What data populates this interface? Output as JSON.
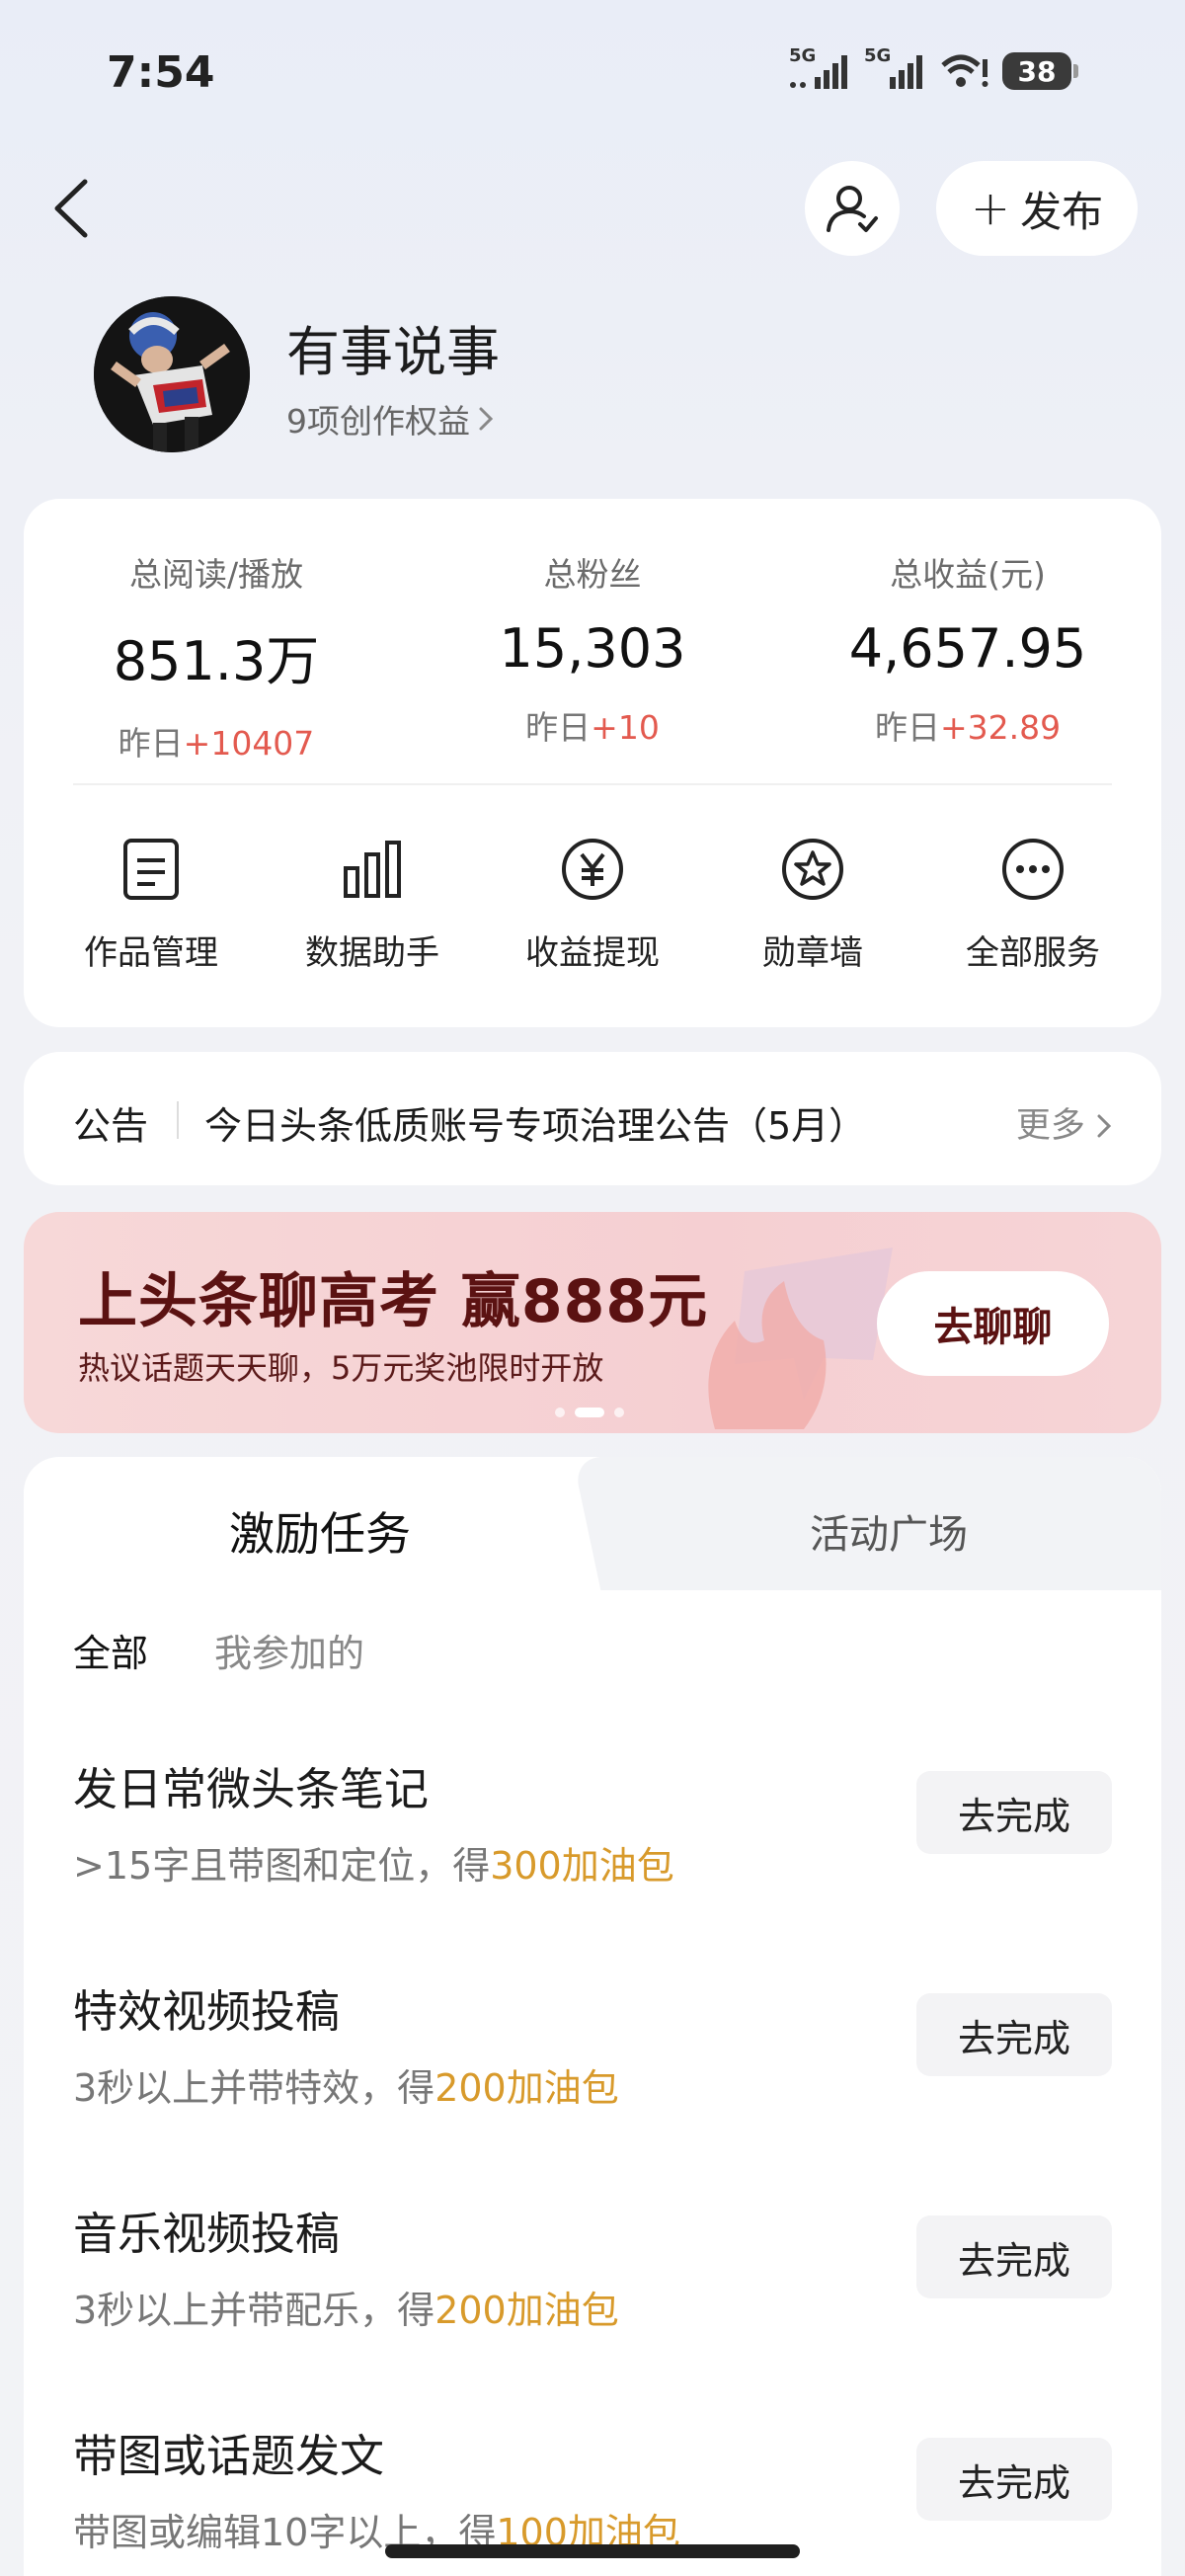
{
  "status_bar": {
    "time": "7:54",
    "network_1": "5G",
    "network_2": "5G",
    "battery": "38"
  },
  "header": {
    "publish_label": "发布"
  },
  "profile": {
    "name": "有事说事",
    "rights": "9项创作权益"
  },
  "stats": [
    {
      "label": "总阅读/播放",
      "value": "851.3万",
      "delta_prefix": "昨日",
      "delta": "+10407"
    },
    {
      "label": "总粉丝",
      "value": "15,303",
      "delta_prefix": "昨日",
      "delta": "+10"
    },
    {
      "label": "总收益(元)",
      "value": "4,657.95",
      "delta_prefix": "昨日",
      "delta": "+32.89"
    }
  ],
  "tools": [
    {
      "label": "作品管理",
      "icon": "document-icon"
    },
    {
      "label": "数据助手",
      "icon": "bar-chart-icon"
    },
    {
      "label": "收益提现",
      "icon": "yuan-icon"
    },
    {
      "label": "勋章墙",
      "icon": "medal-icon"
    },
    {
      "label": "全部服务",
      "icon": "more-icon"
    }
  ],
  "notice": {
    "tag": "公告",
    "text": "今日头条低质账号专项治理公告（5月）",
    "more": "更多"
  },
  "banner": {
    "title": "上头条聊高考 赢888元",
    "subtitle": "热议话题天天聊，5万元奖池限时开放",
    "button": "去聊聊",
    "page_count": 3,
    "active_page": 2
  },
  "tasks": {
    "tabs": [
      "激励任务",
      "活动广场"
    ],
    "active_tab": 0,
    "filters": [
      "全部",
      "我参加的"
    ],
    "items": [
      {
        "title": "发日常微头条笔记",
        "desc": ">15字且带图和定位，得",
        "reward": "300加油包",
        "button": "去完成"
      },
      {
        "title": "特效视频投稿",
        "desc": "3秒以上并带特效，得",
        "reward": "200加油包",
        "button": "去完成"
      },
      {
        "title": "音乐视频投稿",
        "desc": "3秒以上并带配乐，得",
        "reward": "200加油包",
        "button": "去完成"
      },
      {
        "title": "带图或话题发文",
        "desc": "带图或编辑10字以上，得",
        "reward": "100加油包",
        "button": "去完成"
      }
    ]
  },
  "colors": {
    "accent_red": "#e35a4f",
    "reward_gold": "#d89a2b",
    "banner_title": "#5b1212"
  }
}
